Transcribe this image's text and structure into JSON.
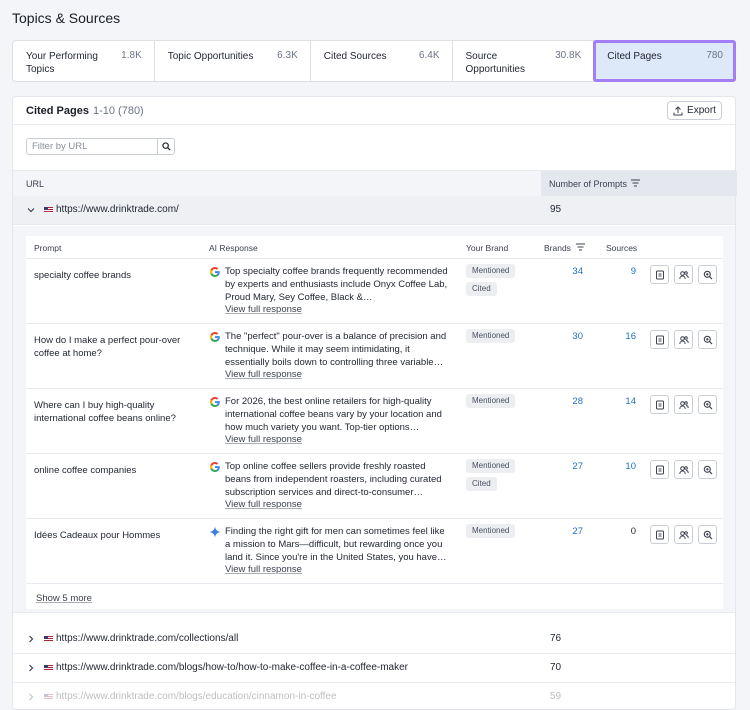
{
  "page": {
    "title": "Topics & Sources"
  },
  "tabs": [
    {
      "label": "Your Performing Topics",
      "count": "1.8K"
    },
    {
      "label": "Topic Opportunities",
      "count": "6.3K"
    },
    {
      "label": "Cited Sources",
      "count": "6.4K"
    },
    {
      "label": "Source Opportunities",
      "count": "30.8K"
    },
    {
      "label": "Cited Pages",
      "count": "780"
    }
  ],
  "active_tab": "Cited Pages",
  "card": {
    "title": "Cited Pages",
    "range": "1-10 (780)",
    "export_label": "Export",
    "filter_placeholder": "Filter by URL"
  },
  "table": {
    "headers": {
      "url": "URL",
      "prompts": "Number of Prompts"
    },
    "rows": [
      {
        "url": "https://www.drinktrade.com/",
        "prompts": "95",
        "expanded": true
      },
      {
        "url": "https://www.drinktrade.com/collections/all",
        "prompts": "76"
      },
      {
        "url": "https://www.drinktrade.com/blogs/how-to/how-to-make-coffee-in-a-coffee-maker",
        "prompts": "70"
      },
      {
        "url": "https://www.drinktrade.com/blogs/education/cinnamon-in-coffee",
        "prompts": "59"
      }
    ]
  },
  "subtable": {
    "headers": {
      "prompt": "Prompt",
      "ai_response": "AI Response",
      "your_brand": "Your Brand",
      "brands": "Brands",
      "sources": "Sources"
    },
    "view_full_label": "View full response",
    "show_more": "Show 5 more",
    "rows": [
      {
        "prompt": "specialty coffee brands",
        "engine_icon": "google-icon",
        "response": "Top specialty coffee brands frequently recommended by experts and enthusiasts include Onyx Coffee Lab, Proud Mary, Sey Coffee, Black &…",
        "badges": [
          "Mentioned",
          "Cited"
        ],
        "brands": "34",
        "sources": "9"
      },
      {
        "prompt": "How do I make a perfect pour-over coffee at home?",
        "engine_icon": "google-icon",
        "response": "The \"perfect\" pour-over is a balance of precision and technique. While it may seem intimidating, it essentially boils down to controlling three variable…",
        "badges": [
          "Mentioned"
        ],
        "brands": "30",
        "sources": "16"
      },
      {
        "prompt": "Where can I buy high-quality international coffee beans online?",
        "engine_icon": "google-icon",
        "response": "For 2026, the best online retailers for high-quality international coffee beans vary by your location and how much variety you want. Top-tier options…",
        "badges": [
          "Mentioned"
        ],
        "brands": "28",
        "sources": "14"
      },
      {
        "prompt": "online coffee companies",
        "engine_icon": "google-icon",
        "response": "Top online coffee sellers provide freshly roasted beans from independent roasters, including curated subscription services and direct-to-consumer…",
        "badges": [
          "Mentioned",
          "Cited"
        ],
        "brands": "27",
        "sources": "10"
      },
      {
        "prompt": "Idées Cadeaux pour Hommes",
        "engine_icon": "gemini-sparkle-icon",
        "response": "Finding the right gift for men can sometimes feel like a mission to Mars—difficult, but rewarding once you land it. Since you're in the United States, you have…",
        "badges": [
          "Mentioned"
        ],
        "brands": "27",
        "sources": "0"
      }
    ]
  },
  "colors": {
    "accent_link": "#1f6fc9",
    "active_tab_bg": "#dde9f8",
    "active_tab_outline": "#a37ef5"
  }
}
